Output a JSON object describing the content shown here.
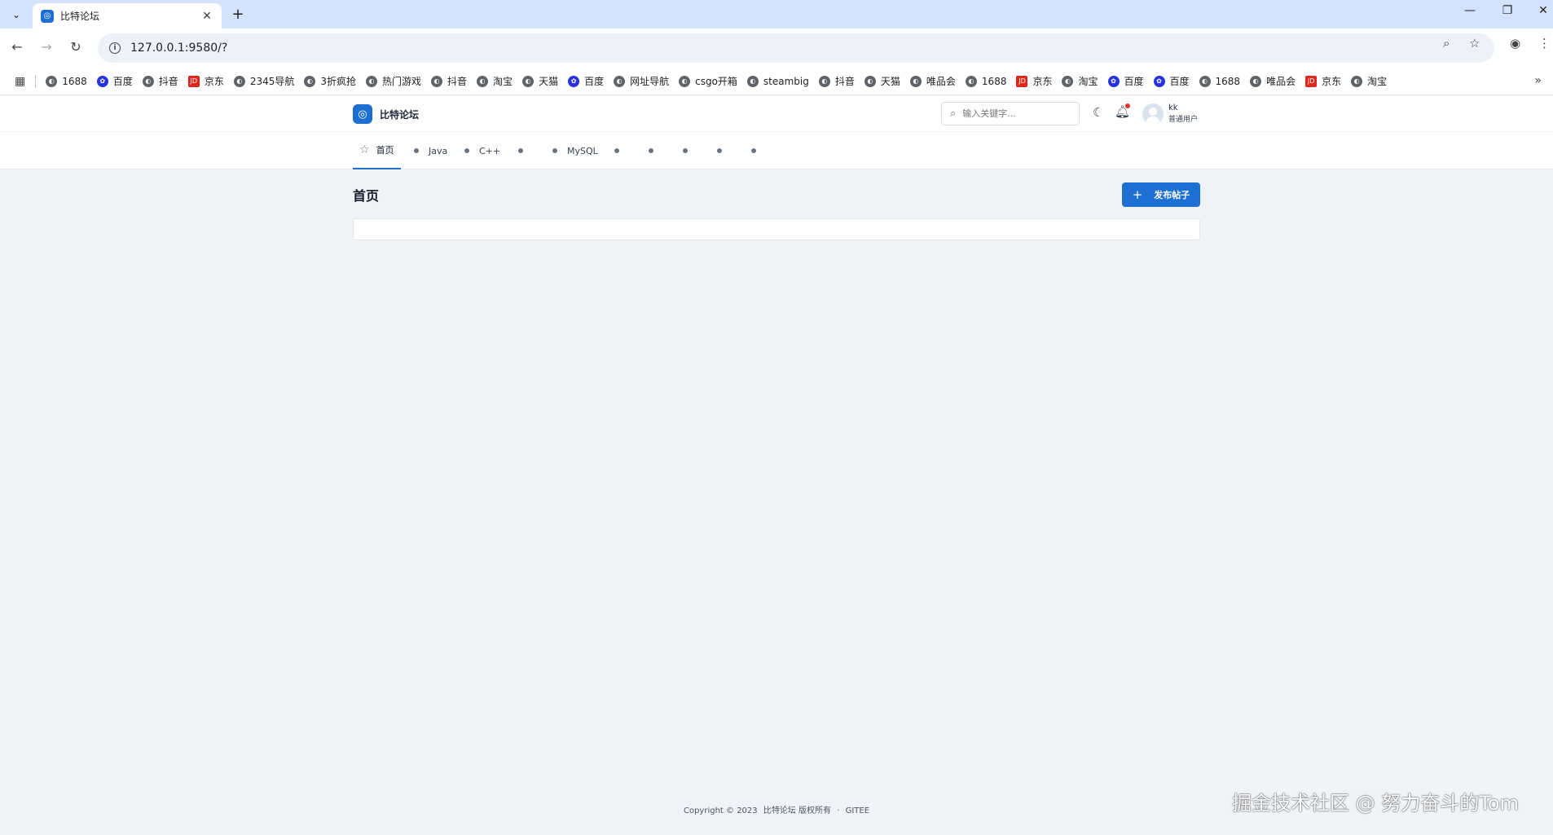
{
  "browser": {
    "tab_title": "比特论坛",
    "url": "127.0.0.1:9580/?",
    "bookmarks": [
      "1688",
      "百度",
      "抖音",
      "京东",
      "2345导航",
      "3折疯抢",
      "热门游戏",
      "抖音",
      "淘宝",
      "天猫",
      "百度",
      "网址导航",
      "csgo开箱",
      "steambig",
      "抖音",
      "天猫",
      "唯品会",
      "1688",
      "京东",
      "淘宝",
      "百度",
      "百度",
      "1688",
      "唯品会",
      "京东",
      "淘宝"
    ],
    "bookmark_icons": [
      "globe",
      "baidu",
      "globe",
      "jd",
      "globe",
      "globe",
      "globe",
      "globe",
      "globe",
      "globe",
      "baidu",
      "globe",
      "globe",
      "globe",
      "globe",
      "globe",
      "globe",
      "globe",
      "jd",
      "globe",
      "baidu",
      "baidu",
      "globe",
      "globe",
      "jd",
      "globe"
    ]
  },
  "header": {
    "site_name": "比特论坛",
    "search_placeholder": "输入关键字...",
    "user_name": "kk",
    "user_role": "普通用户"
  },
  "nav": {
    "home_label": "首页",
    "items": [
      "Java",
      "C++",
      "",
      "MySQL",
      "",
      "",
      "",
      "",
      ""
    ]
  },
  "main": {
    "page_title": "首页",
    "publish_label": "发布帖子"
  },
  "footer": {
    "copyright": "Copyright © 2023",
    "site": "比特论坛 版权所有",
    "separator": "·",
    "link": "GITEE"
  },
  "watermark": "掘金技术社区 @ 努力奋斗的Tom",
  "colors": {
    "primary": "#1d6fd1",
    "background": "#f0f4f8",
    "notification_dot": "#e03131"
  }
}
